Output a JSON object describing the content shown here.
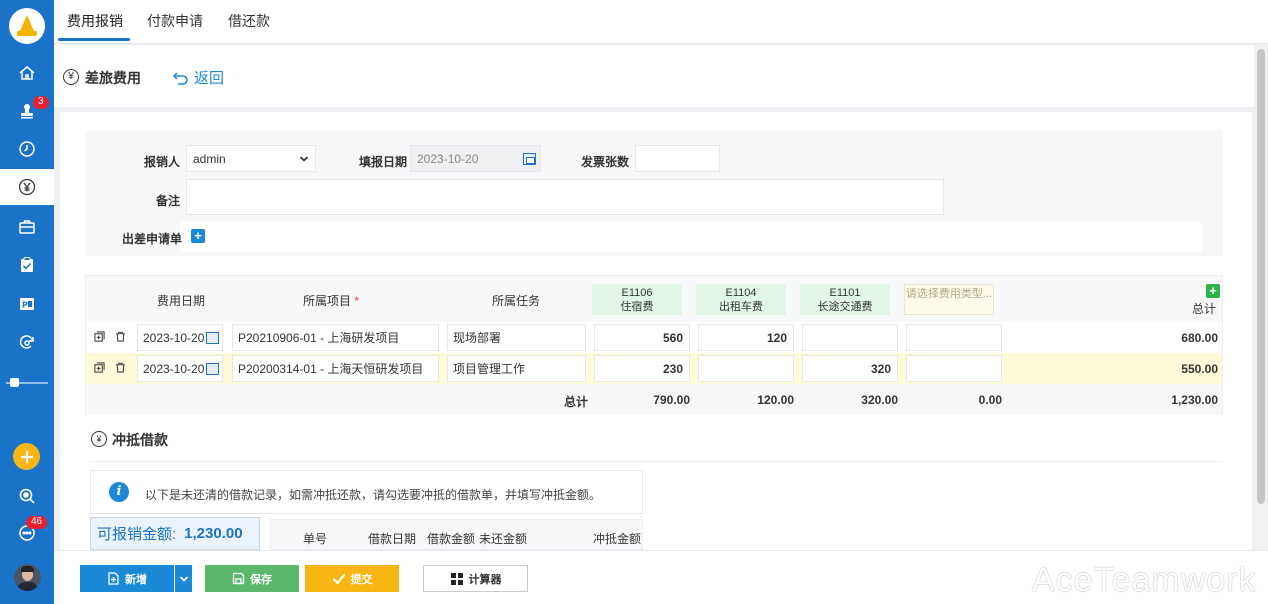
{
  "sidebar": {
    "badges": {
      "stamp": "3",
      "chat": "46"
    },
    "icons": [
      "home-icon",
      "stamp-icon",
      "clock-icon",
      "yen-icon",
      "briefcase-icon",
      "clipboard-icon",
      "ppt-icon",
      "refresh-icon",
      "slider-icon",
      "plus-icon",
      "search-icon",
      "chat-icon"
    ]
  },
  "tabs": [
    {
      "label": "费用报销"
    },
    {
      "label": "付款申请"
    },
    {
      "label": "借还款"
    }
  ],
  "page": {
    "title": "差旅费用",
    "back_label": "返回"
  },
  "form": {
    "reporter_label": "报销人",
    "reporter_value": "admin",
    "date_label": "填报日期",
    "date_value": "2023-10-20",
    "invoice_label": "发票张数",
    "invoice_value": "",
    "remark_label": "备注",
    "remark_value": "",
    "trip_label": "出差申请单"
  },
  "table": {
    "headers": {
      "date": "费用日期",
      "project": "所属项目",
      "task": "所属任务",
      "total": "总计"
    },
    "expense_columns": [
      {
        "code": "E1106",
        "name": "住宿费"
      },
      {
        "code": "E1104",
        "name": "出租车费"
      },
      {
        "code": "E1101",
        "name": "长途交通费"
      }
    ],
    "placeholder_column": "请选择费用类型...",
    "rows": [
      {
        "date": "2023-10-20",
        "project": "P20210906-01 - 上海研发项目",
        "task": "现场部署",
        "e1106": "560",
        "e1104": "120",
        "e1101": "",
        "extra": "",
        "total": "680.00"
      },
      {
        "date": "2023-10-20",
        "project": "P20200314-01 - 上海天恒研发项目",
        "task": "项目管理工作",
        "e1106": "230",
        "e1104": "",
        "e1101": "320",
        "extra": "",
        "total": "550.00"
      }
    ],
    "footer": {
      "label": "总计",
      "e1106": "790.00",
      "e1104": "120.00",
      "e1101": "320.00",
      "extra": "0.00",
      "total": "1,230.00"
    }
  },
  "loan": {
    "title": "冲抵借款",
    "info": "以下是未还清的借款记录，如需冲抵还款，请勾选要冲抵的借款单，并填写冲抵金额。",
    "available_label": "可报销金额:",
    "available_value": "1,230.00",
    "headers": {
      "no": "单号",
      "date": "借款日期",
      "amount": "借款金额",
      "unpaid": "未还金额",
      "offset": "冲抵金额"
    }
  },
  "actions": {
    "new": "新增",
    "save": "保存",
    "submit": "提交",
    "calculator": "计算器"
  },
  "watermark": "AceTeamwork"
}
